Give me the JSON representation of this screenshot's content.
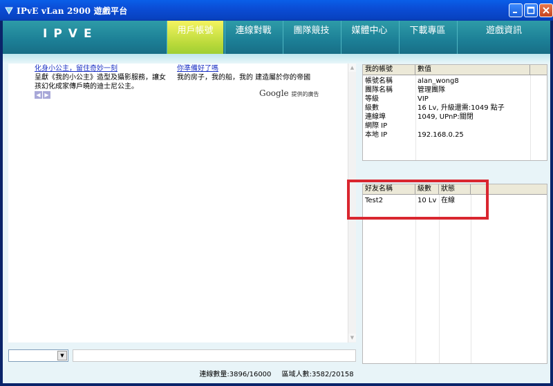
{
  "window": {
    "title": "IPvE vLan 2900 遊戲平台"
  },
  "nav": {
    "logo_text": "IPVE",
    "items": [
      {
        "label": "用戶帳號",
        "active": true
      },
      {
        "label": "連線對戰",
        "active": false
      },
      {
        "label": "團隊競技",
        "active": false
      },
      {
        "label": "媒體中心",
        "active": false
      },
      {
        "label": "下載專區",
        "active": false
      },
      {
        "label": "遊戲資訊",
        "active": false
      }
    ]
  },
  "ads": [
    {
      "title": "化身小公主，留住奇妙一刻",
      "body": "呈獻《我的小公主》造型及攝影服務，讓女孩幻化成家傳戶曉的迪士尼公主。"
    },
    {
      "title": "你準備好了嗎",
      "body": "我的房子，我的船，我的 建造屬於你的帝國"
    }
  ],
  "ad_footer": {
    "brand": "Google",
    "note": "提供的廣告"
  },
  "account_table": {
    "headers": [
      "我的帳號",
      "數值"
    ],
    "rows": [
      [
        "帳號名稱",
        "alan_wong8"
      ],
      [
        "團隊名稱",
        "管理團隊"
      ],
      [
        "等級",
        "VIP"
      ],
      [
        "級數",
        "16 Lv, 升級還需:1049 點子"
      ],
      [
        "連線埠",
        "1049, UPnP:關閉"
      ],
      [
        "網際 IP",
        ""
      ],
      [
        "本地 IP",
        "192.168.0.25"
      ]
    ]
  },
  "friends_table": {
    "headers": [
      "好友名稱",
      "級數",
      "狀態"
    ],
    "rows": [
      [
        "Test2",
        "10 Lv",
        "在線"
      ]
    ]
  },
  "status": {
    "connections": "連線數量:3896/16000",
    "region": "區域人數:3582/20158"
  },
  "colors": {
    "nav": "#1c7f96",
    "active_tab": "#b9d93a",
    "highlight": "#d9262f"
  }
}
